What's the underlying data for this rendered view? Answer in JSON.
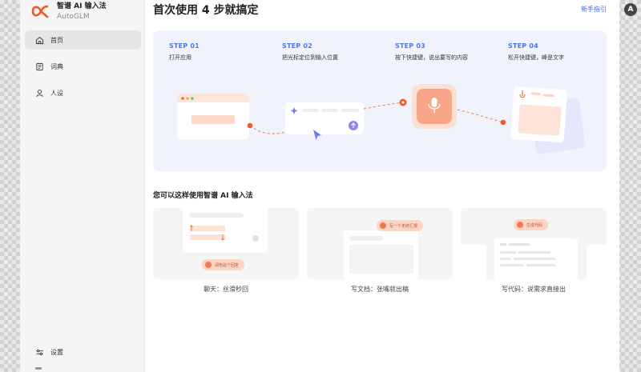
{
  "brand": {
    "name": "智谱 AI 输入法",
    "subtitle": "AutoGLM",
    "accent": "#f05a28"
  },
  "sidebar": {
    "items": [
      {
        "label": "首页",
        "icon": "home-icon"
      },
      {
        "label": "词典",
        "icon": "dictionary-icon"
      },
      {
        "label": "人设",
        "icon": "person-icon"
      }
    ],
    "settings_label": "设置"
  },
  "main": {
    "title": "首次使用 4 步就搞定",
    "guide_link": "新手指引",
    "steps": [
      {
        "title": "STEP 01",
        "desc": "打开应用"
      },
      {
        "title": "STEP 02",
        "desc": "把光标定位到输入位置"
      },
      {
        "title": "STEP 03",
        "desc": "按下快捷键，说出要写的内容"
      },
      {
        "title": "STEP 04",
        "desc": "松开快捷键，峰是文字"
      }
    ],
    "section_title": "您可以这样使用智谱 AI 输入法",
    "examples": [
      {
        "caption": "聊天：丝滑秒回",
        "pill": "润色这个回复"
      },
      {
        "caption": "写文档：张嘴就出稿",
        "pill": "写一个年终汇报"
      },
      {
        "caption": "写代码：说需求直接出",
        "pill": "生成代码"
      }
    ]
  },
  "colors": {
    "step_accent": "#4d78ec",
    "link": "#3b6df0",
    "orange": "#f05a28",
    "steps_bg": "#f1f3fc"
  }
}
